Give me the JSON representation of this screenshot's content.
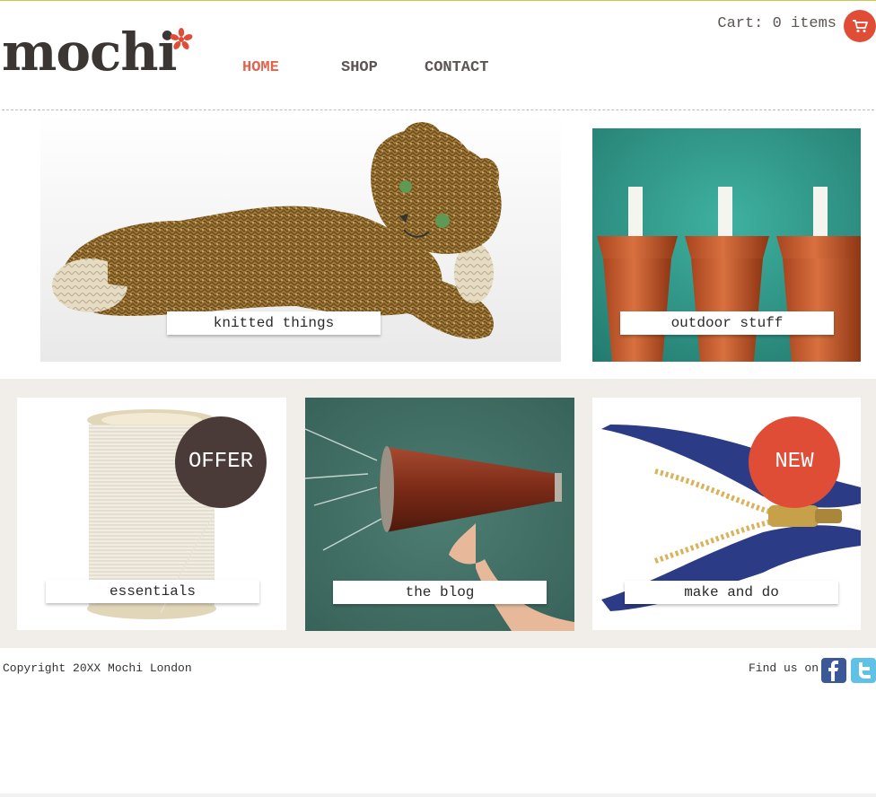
{
  "brand": {
    "name": "mochi",
    "accent": "#e04d36",
    "dark": "#3b3533"
  },
  "nav": {
    "items": [
      "HOME",
      "SHOP",
      "CONTACT"
    ],
    "active": "HOME"
  },
  "cart": {
    "label": "Cart: 0 items",
    "icon": "cart-icon"
  },
  "tiles": {
    "knitted": "knitted things",
    "outdoor": "outdoor stuff",
    "essentials": "essentials",
    "blog": "the blog",
    "make": "make and do"
  },
  "badges": {
    "offer": "OFFER",
    "new": "NEW"
  },
  "footer": {
    "copyright": "Copyright 20XX Mochi London",
    "find_us": "Find us on",
    "social": [
      "facebook-icon",
      "twitter-icon"
    ]
  }
}
